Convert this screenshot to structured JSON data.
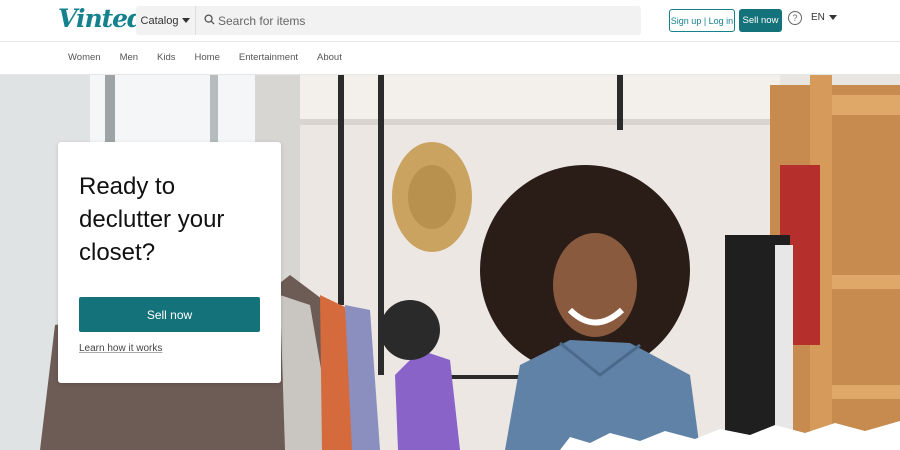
{
  "header": {
    "logo_text": "Vinted",
    "catalog_label": "Catalog",
    "search_placeholder": "Search for items",
    "signup_label": "Sign up | Log in",
    "sell_label": "Sell now",
    "help_icon": "question-circle-icon",
    "language": "EN"
  },
  "nav": {
    "items": [
      "Women",
      "Men",
      "Kids",
      "Home",
      "Entertainment",
      "About"
    ]
  },
  "hero": {
    "title": "Ready to declutter your closet?",
    "button_label": "Sell now",
    "link_label": "Learn how it works"
  },
  "colors": {
    "brand": "#14828c",
    "button": "#14727b"
  }
}
